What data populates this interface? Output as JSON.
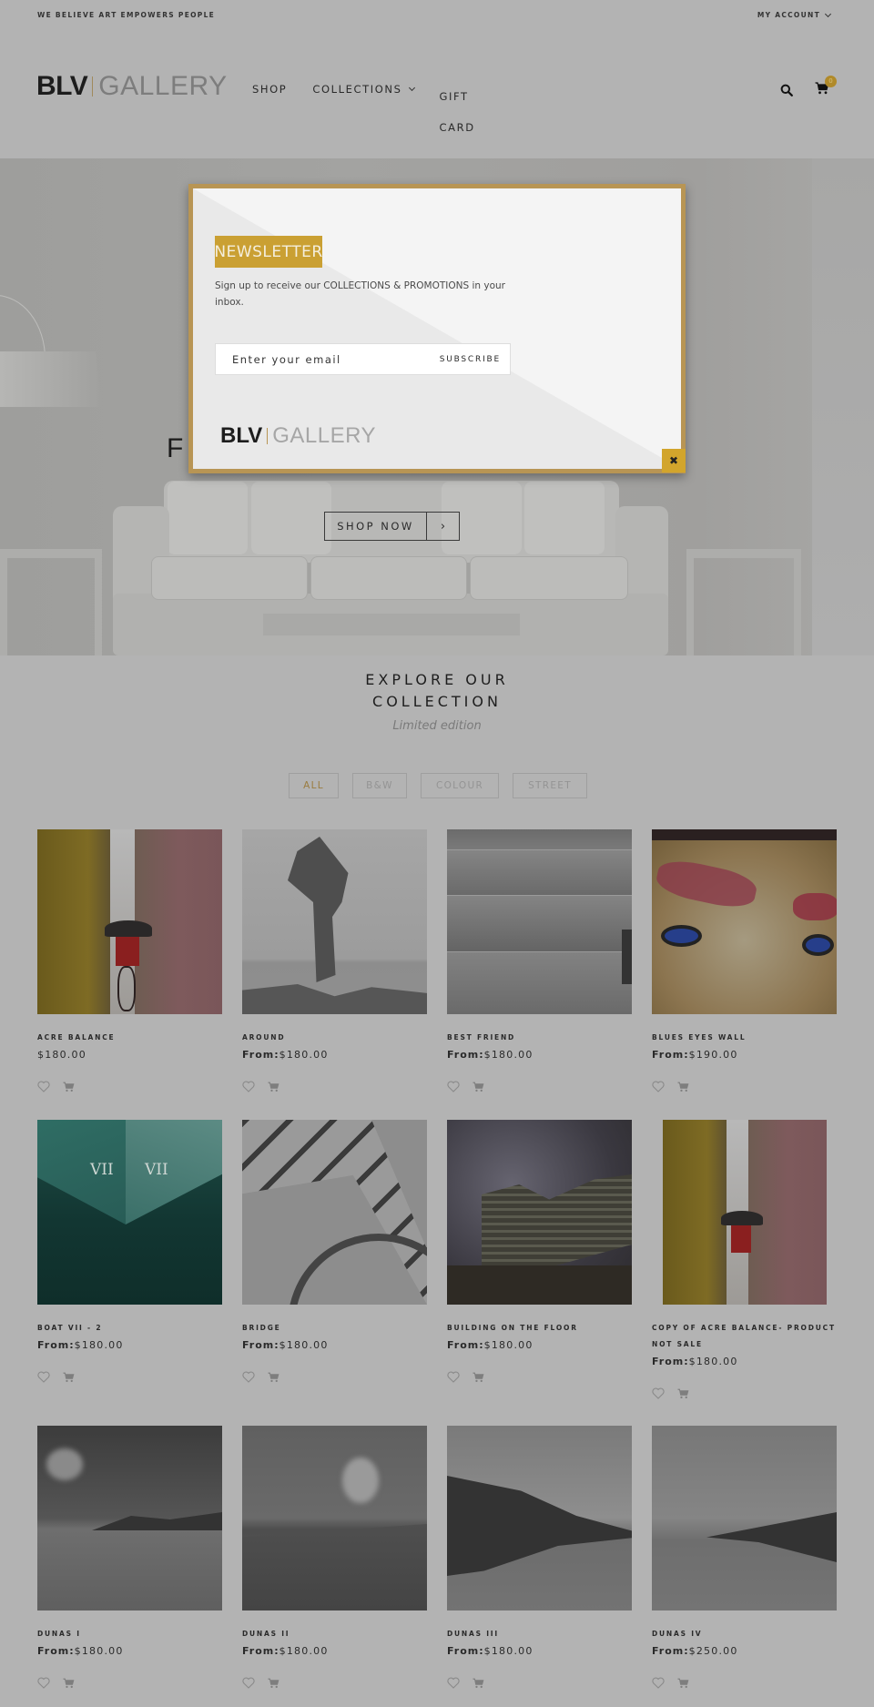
{
  "topbar": {
    "tagline": "WE BELIEVE ART EMPOWERS PEOPLE",
    "account_label": "MY ACCOUNT"
  },
  "header": {
    "logo_bold": "BLV",
    "logo_light": "GALLERY",
    "nav": [
      {
        "label": "SHOP"
      },
      {
        "label": "COLLECTIONS",
        "has_dropdown": true
      },
      {
        "label": "GIFT CARD"
      }
    ],
    "cart_count": "0",
    "accent_color": "#b08a2a"
  },
  "hero": {
    "heading_partial": "F",
    "cta_label": "SHOP NOW",
    "cta_arrow": "›"
  },
  "newsletter": {
    "badge": "NEWSLETTER",
    "description": "Sign up to receive our COLLECTIONS & PROMOTIONS in your inbox.",
    "email_placeholder": "Enter your email",
    "email_value": "",
    "subscribe_label": "SUBSCRIBE",
    "logo_bold": "BLV",
    "logo_light": "GALLERY",
    "close_glyph": "✖",
    "frame_color": "#b89554",
    "badge_color": "#caa033"
  },
  "collection": {
    "title_line1": "EXPLORE OUR",
    "title_line2": "COLLECTION",
    "subtitle": "Limited edition",
    "filters": [
      {
        "label": "ALL",
        "active": true
      },
      {
        "label": "B&W",
        "active": false
      },
      {
        "label": "COLOUR",
        "active": false
      },
      {
        "label": "STREET",
        "active": false
      }
    ]
  },
  "products": [
    {
      "name": "ACRE BALANCE",
      "price_prefix": "",
      "price": "$180.00"
    },
    {
      "name": "AROUND",
      "price_prefix": "From:",
      "price": "$180.00"
    },
    {
      "name": "BEST FRIEND",
      "price_prefix": "From:",
      "price": "$180.00"
    },
    {
      "name": "BLUES EYES WALL",
      "price_prefix": "From:",
      "price": "$190.00"
    },
    {
      "name": "BOAT VII - 2",
      "price_prefix": "From:",
      "price": "$180.00"
    },
    {
      "name": "BRIDGE",
      "price_prefix": "From:",
      "price": "$180.00"
    },
    {
      "name": "BUILDING ON THE FLOOR",
      "price_prefix": "From:",
      "price": "$180.00"
    },
    {
      "name": "COPY OF ACRE BALANCE- PRODUCT NOT SALE",
      "price_prefix": "From:",
      "price": "$180.00"
    },
    {
      "name": "DUNAS I",
      "price_prefix": "From:",
      "price": "$180.00"
    },
    {
      "name": "DUNAS II",
      "price_prefix": "From:",
      "price": "$180.00"
    },
    {
      "name": "DUNAS III",
      "price_prefix": "From:",
      "price": "$180.00"
    },
    {
      "name": "DUNAS IV",
      "price_prefix": "From:",
      "price": "$250.00"
    }
  ]
}
